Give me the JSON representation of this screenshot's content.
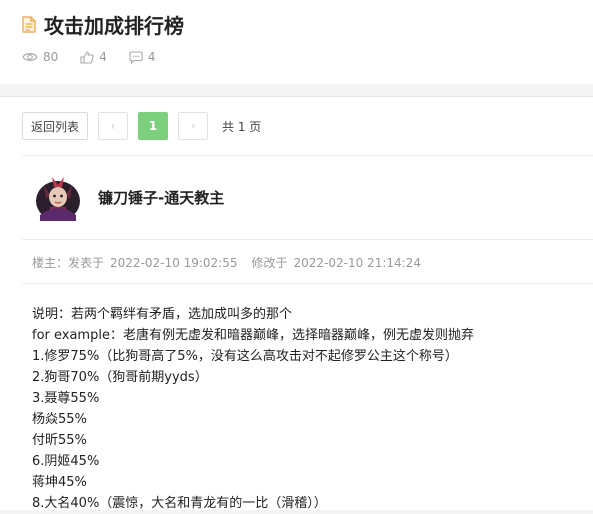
{
  "header": {
    "title": "攻击加成排行榜",
    "views": "80",
    "likes": "4",
    "comments": "4"
  },
  "pager": {
    "back_label": "返回列表",
    "prev_icon": "‹",
    "current_page": "1",
    "next_icon": "›",
    "total_label": "共 1 页"
  },
  "post": {
    "author": "镰刀锤子-通天教主",
    "floor_label": "楼主：",
    "posted_prefix": "发表于",
    "posted_time": "2022-02-10 19:02:55",
    "modified_prefix": "修改于",
    "modified_time": "2022-02-10 21:14:24",
    "lines": [
      "说明：若两个羁绊有矛盾，选加成叫多的那个",
      "for example：老唐有例无虚发和暗器巅峰，选择暗器巅峰，例无虚发则抛弃",
      "1.修罗75%（比狗哥高了5%，没有这么高攻击对不起修罗公主这个称号）",
      "2.狗哥70%（狗哥前期yyds）",
      "3.聂尊55%",
      "杨焱55%",
      "付昕55%",
      "6.阴姬45%",
      "蒋坤45%",
      "8.大名40%（震惊，大名和青龙有的一比（滑稽））"
    ]
  },
  "icons": {
    "doc": "document-icon",
    "views": "eye-icon",
    "likes": "thumbs-up-icon",
    "comments": "comment-icon"
  },
  "colors": {
    "accent": "#7ccf7c",
    "doc_icon": "#e8a33d",
    "muted": "#999999"
  }
}
